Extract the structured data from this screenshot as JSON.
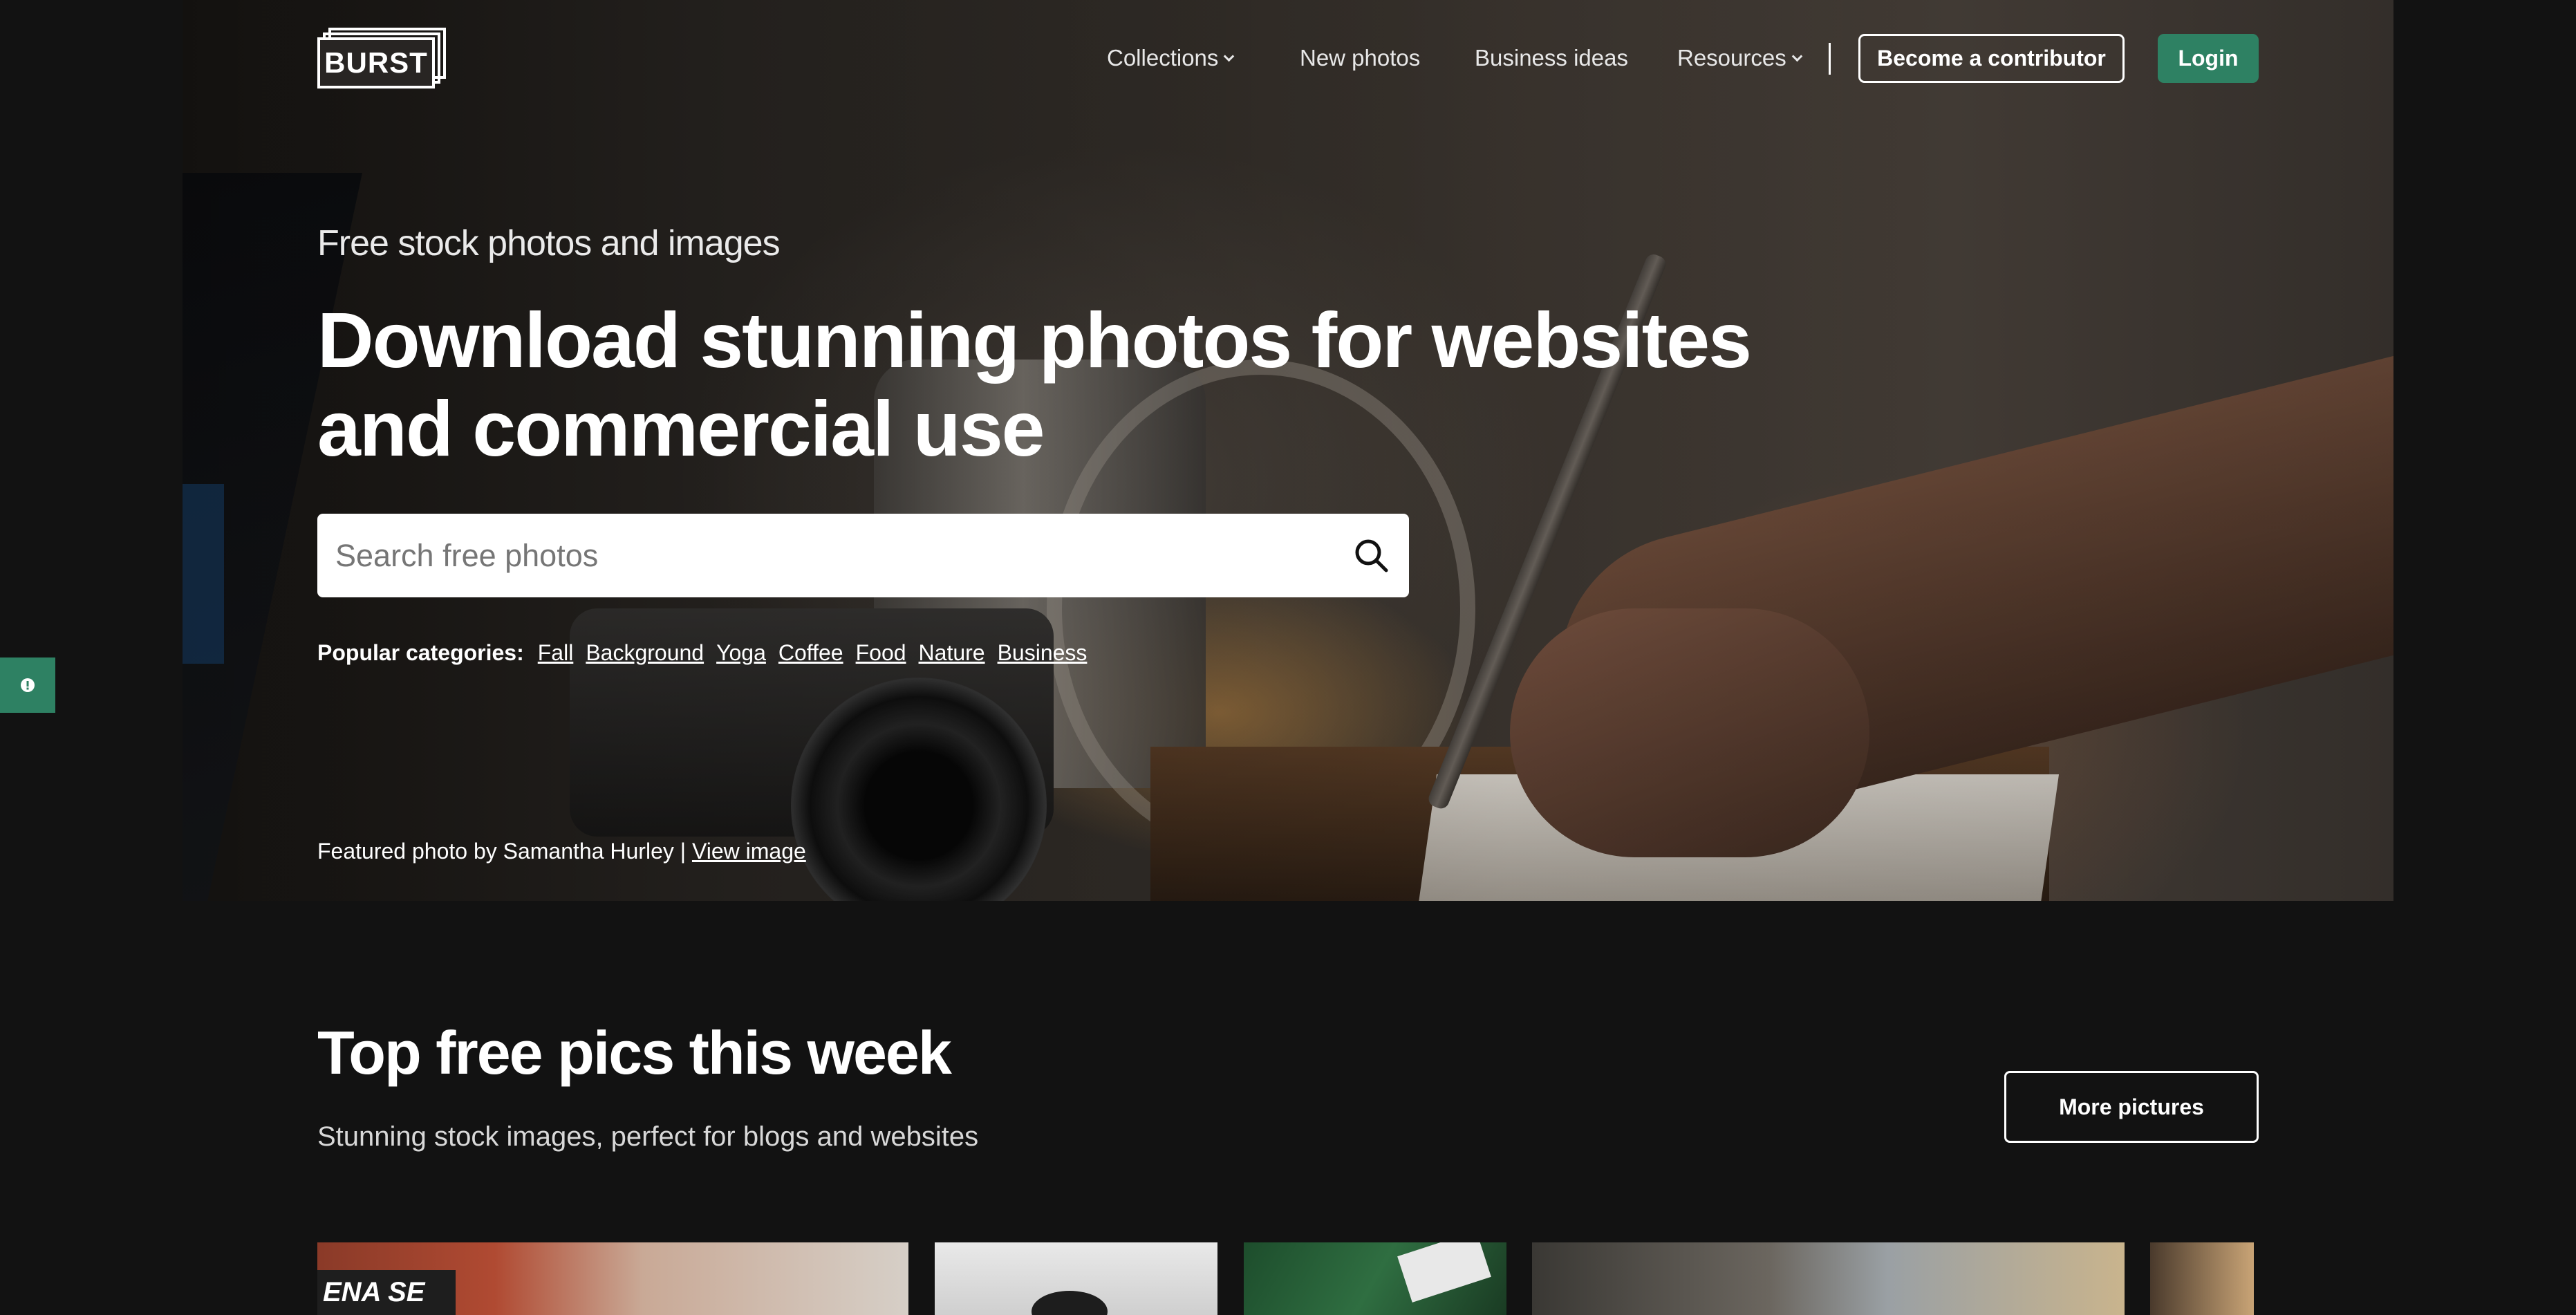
{
  "brand": {
    "logo_text": "BURST"
  },
  "nav": {
    "items": [
      {
        "label": "Collections",
        "has_dropdown": true
      },
      {
        "label": "New photos",
        "has_dropdown": false
      },
      {
        "label": "Business ideas",
        "has_dropdown": false
      },
      {
        "label": "Resources",
        "has_dropdown": true
      }
    ],
    "contributor_label": "Become a contributor",
    "login_label": "Login"
  },
  "hero": {
    "eyebrow": "Free stock photos and images",
    "headline": "Download stunning photos for websites and commercial use",
    "search": {
      "placeholder": "Search free photos",
      "value": ""
    },
    "categories_label": "Popular categories:",
    "categories": [
      "Fall",
      "Background",
      "Yoga",
      "Coffee",
      "Food",
      "Nature",
      "Business"
    ],
    "credit_text": "Featured photo by Samantha Hurley | ",
    "credit_link": "View image"
  },
  "top_pics": {
    "title": "Top free pics this week",
    "subtitle": "Stunning stock images, perfect for blogs and websites",
    "more_label": "More pictures",
    "thumb1_sign": "ENA SE"
  },
  "colors": {
    "accent": "#2e8163",
    "background": "#121212",
    "text": "#ffffff"
  },
  "icons": {
    "search": "search-icon",
    "dropdown": "chevron-down-icon",
    "feedback": "alert-icon"
  }
}
